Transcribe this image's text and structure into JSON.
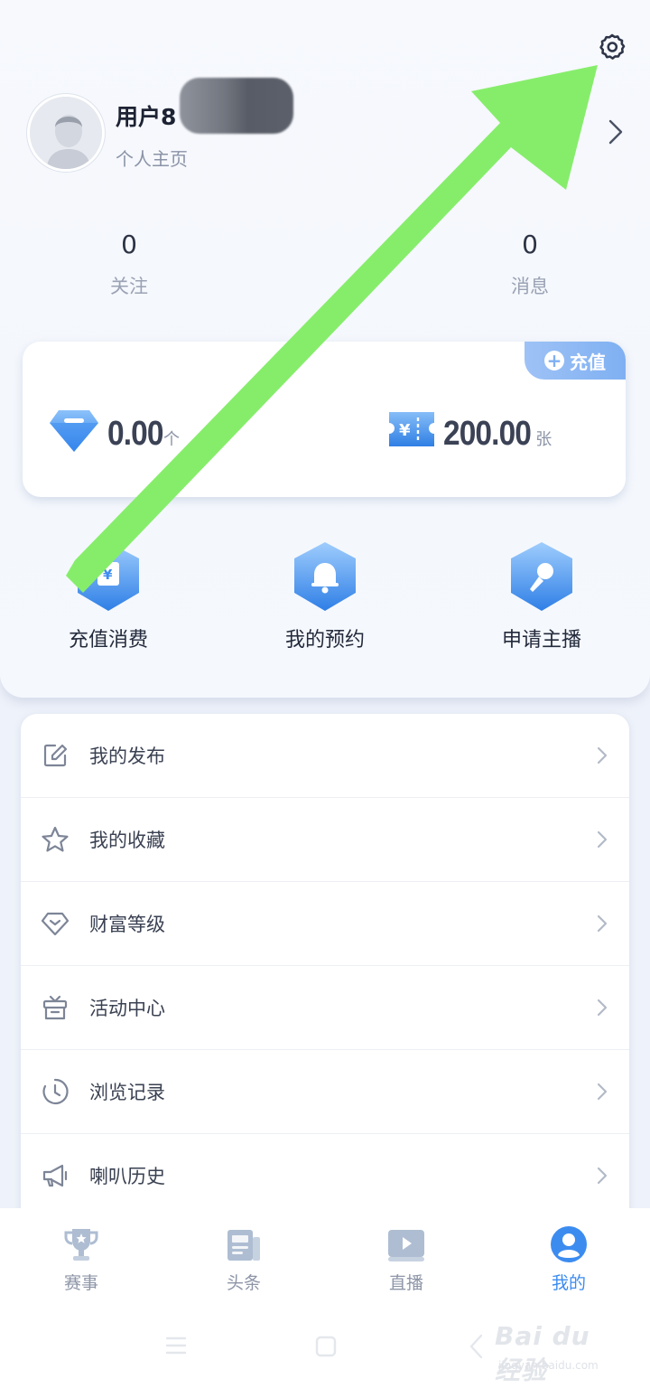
{
  "profile": {
    "username": "用户8",
    "homepage_label": "个人主页"
  },
  "stats": {
    "follow": {
      "count": "0",
      "label": "关注"
    },
    "messages": {
      "count": "0",
      "label": "消息"
    }
  },
  "wallet": {
    "recharge_label": "充值",
    "diamonds": {
      "amount": "0.00",
      "unit": "个"
    },
    "tickets": {
      "amount": "200.00",
      "unit": "张"
    }
  },
  "quick_actions": [
    {
      "label": "充值消费",
      "icon": "yuan-card-icon"
    },
    {
      "label": "我的预约",
      "icon": "bell-icon"
    },
    {
      "label": "申请主播",
      "icon": "microphone-icon"
    }
  ],
  "menu": [
    {
      "label": "我的发布",
      "icon": "edit-icon"
    },
    {
      "label": "我的收藏",
      "icon": "star-icon"
    },
    {
      "label": "财富等级",
      "icon": "diamond-icon"
    },
    {
      "label": "活动中心",
      "icon": "gift-icon"
    },
    {
      "label": "浏览记录",
      "icon": "clock-icon"
    },
    {
      "label": "喇叭历史",
      "icon": "megaphone-icon"
    }
  ],
  "tabs": [
    {
      "label": "赛事",
      "icon": "trophy-icon",
      "active": false
    },
    {
      "label": "头条",
      "icon": "news-icon",
      "active": false
    },
    {
      "label": "直播",
      "icon": "play-icon",
      "active": false
    },
    {
      "label": "我的",
      "icon": "user-icon",
      "active": true
    }
  ],
  "watermark": {
    "main": "Bai du 经验",
    "sub": "jingyan.baidu.com"
  },
  "colors": {
    "accent": "#3c8cf0",
    "annotation_arrow": "#86ed6b",
    "badge": "#8ab8f4"
  }
}
